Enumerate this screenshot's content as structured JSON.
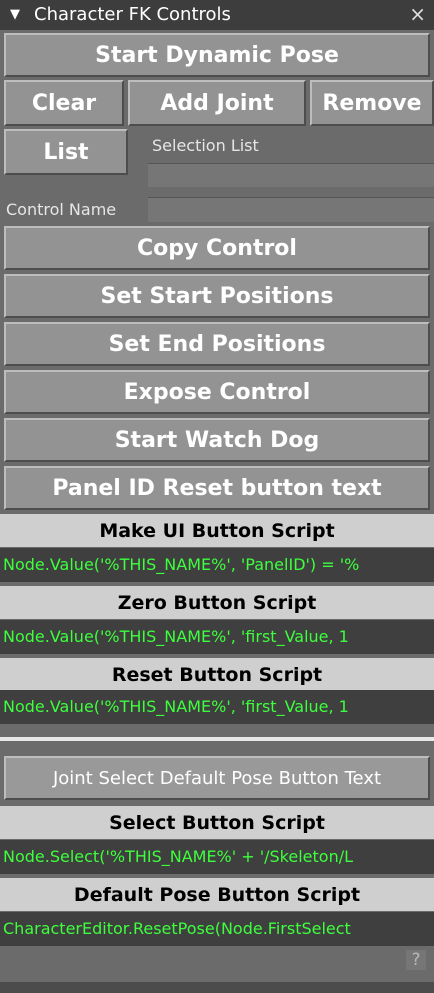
{
  "titlebar": {
    "title": "Character FK Controls",
    "collapse_icon": "triangle-down",
    "close_glyph": "×"
  },
  "buttons": {
    "start_dynamic_pose": "Start Dynamic Pose",
    "clear": "Clear",
    "add_joint": "Add Joint",
    "remove": "Remove",
    "list": "List",
    "copy_control": "Copy Control",
    "set_start_positions": "Set Start Positions",
    "set_end_positions": "Set End Positions",
    "expose_control": "Expose Control",
    "start_watch_dog": "Start Watch Dog",
    "panel_id_reset": "Panel ID Reset button text",
    "joint_select_default_pose": "Joint Select Default Pose Button Text"
  },
  "labels": {
    "selection_list": "Selection List",
    "control_name": "Control Name"
  },
  "sections": [
    {
      "header": "Make UI Button Script",
      "script": "Node.Value('%THIS_NAME%', 'PanelID') = '%"
    },
    {
      "header": "Zero Button Script",
      "script": "Node.Value('%THIS_NAME%', 'first_Value, 1"
    },
    {
      "header": "Reset Button Script",
      "script": "Node.Value('%THIS_NAME%', 'first_Value, 1"
    }
  ],
  "sections2": [
    {
      "header": "Select Button Script",
      "script": "Node.Select('%THIS_NAME%' + '/Skeleton/L"
    },
    {
      "header": "Default Pose Button Script",
      "script": "CharacterEditor.ResetPose(Node.FirstSelect"
    }
  ],
  "help": "?",
  "colors": {
    "script_text": "#3dff3d",
    "header_bg": "#cfcfcf",
    "button_bg": "#939393"
  }
}
